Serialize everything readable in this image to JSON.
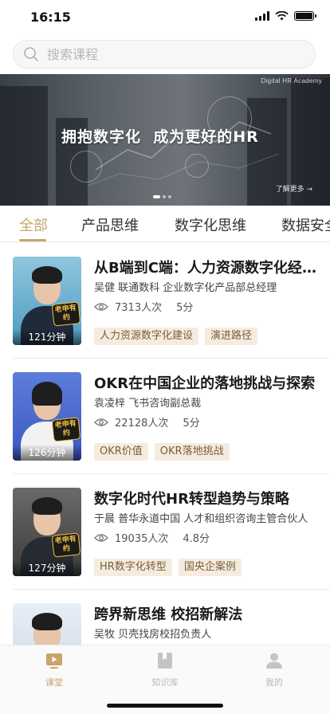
{
  "status_bar": {
    "time": "16:15"
  },
  "search": {
    "placeholder": "搜索课程"
  },
  "banner": {
    "brand": "Digital HR Academy",
    "title": "拥抱数字化  成为更好的HR",
    "more": "了解更多 →"
  },
  "tabs": [
    {
      "label": "全部",
      "active": true
    },
    {
      "label": "产品思维",
      "active": false
    },
    {
      "label": "数字化思维",
      "active": false
    },
    {
      "label": "数据安全",
      "active": false
    }
  ],
  "courses": [
    {
      "title": "从B端到C端：人力资源数字化经验分享",
      "speaker": "吴健  联通数科 企业数字化产品部总经理",
      "views": "7313人次",
      "duration": "5分",
      "thumb_duration": "121分钟",
      "badge": "老申有约",
      "tags": [
        "人力资源数字化建设",
        "演进路径"
      ]
    },
    {
      "title": "OKR在中国企业的落地挑战与探索",
      "speaker": "袁凌梓  飞书咨询副总裁",
      "views": "22128人次",
      "duration": "5分",
      "thumb_duration": "126分钟",
      "badge": "老申有约",
      "tags": [
        "OKR价值",
        "OKR落地挑战"
      ]
    },
    {
      "title": "数字化时代HR转型趋势与策略",
      "speaker": "于晨  普华永道中国 人才和组织咨询主管合伙人",
      "views": "19035人次",
      "duration": "4.8分",
      "thumb_duration": "127分钟",
      "badge": "老申有约",
      "tags": [
        "HR数字化转型",
        "国央企案例"
      ]
    },
    {
      "title": "跨界新思维 校招新解法",
      "speaker": "吴牧  贝壳找房校招负责人",
      "views": "",
      "duration": "",
      "thumb_duration": "",
      "badge": "",
      "tags": []
    }
  ],
  "bottom_nav": [
    {
      "label": "课堂",
      "icon": "classroom-icon",
      "active": true
    },
    {
      "label": "知识库",
      "icon": "book-icon",
      "active": false
    },
    {
      "label": "我的",
      "icon": "profile-icon",
      "active": false
    }
  ],
  "colors": {
    "accent": "#c9a56b",
    "tag_bg": "#f5ece0",
    "tag_text": "#7a5d36"
  }
}
